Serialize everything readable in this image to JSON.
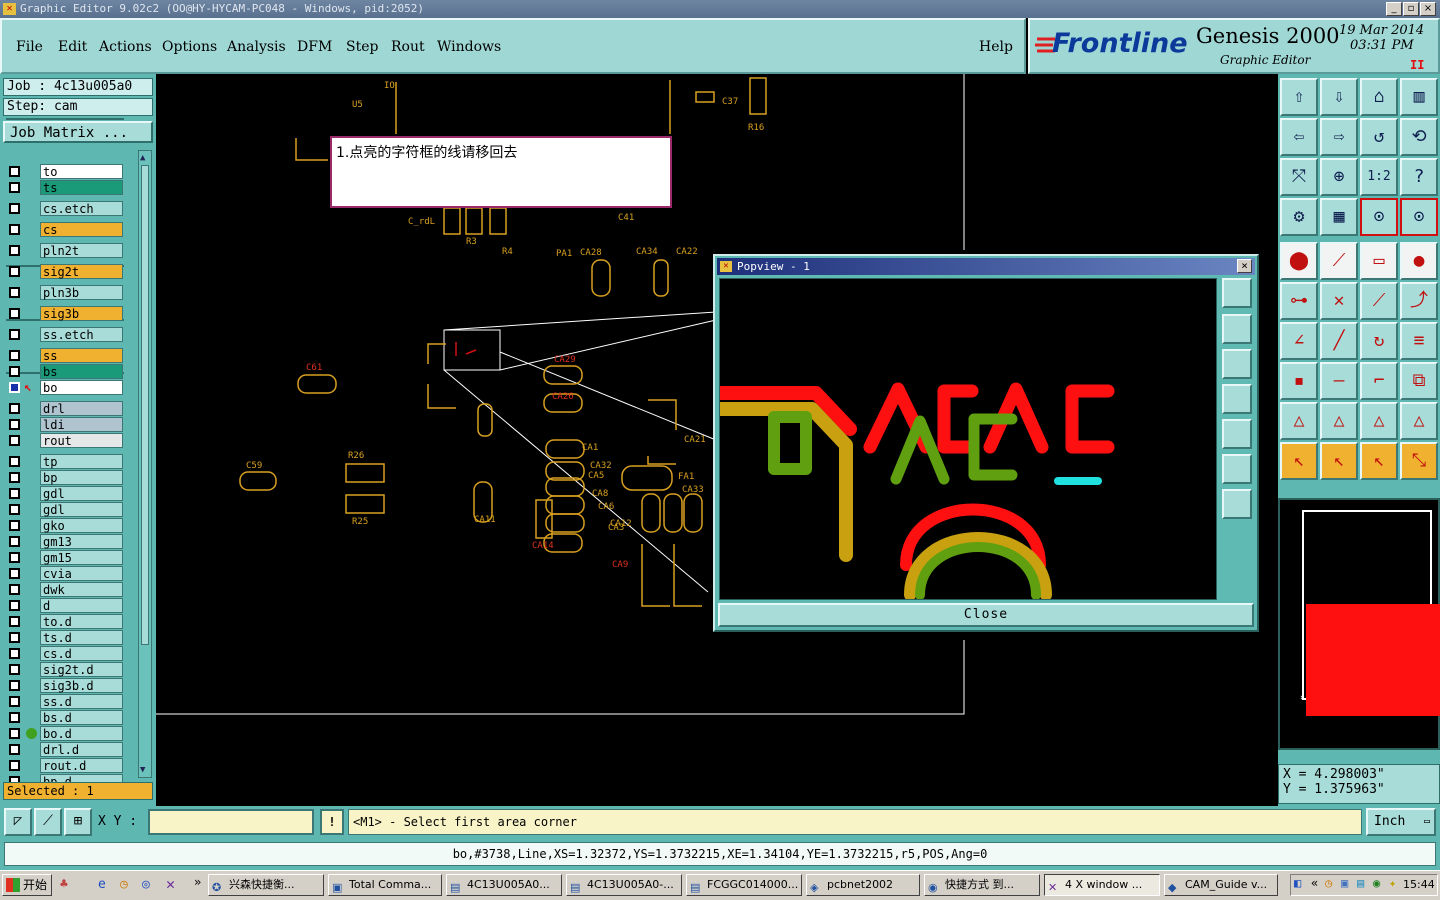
{
  "window": {
    "title": "Graphic Editor 9.02c2 (OO@HY-HYCAM-PC048 - Windows, pid:2052)"
  },
  "menu": {
    "items": [
      "File",
      "Edit",
      "Actions",
      "Options",
      "Analysis",
      "DFM",
      "Step",
      "Rout",
      "Windows"
    ],
    "help": "Help"
  },
  "brand": {
    "company": "Frontline",
    "product": "Genesis 2000",
    "subtitle": "Graphic Editor",
    "date": "19 Mar 2014",
    "time": "03:31 PM"
  },
  "job": {
    "job_label": "Job : 4c13u005a0",
    "step_label": "Step: cam",
    "matrix_button": "Job Matrix ..."
  },
  "layers": [
    {
      "name": "to",
      "color": "#ffffff",
      "on": false
    },
    {
      "name": "ts",
      "color": "#1a9a78",
      "on": false
    },
    {
      "name": "cs.etch",
      "color": "#a8dcd8",
      "on": false
    },
    {
      "name": "cs",
      "color": "#f0b030",
      "on": false
    },
    {
      "name": "pln2t",
      "color": "#a8dcd8",
      "on": false
    },
    {
      "name": "sig2t",
      "color": "#f0b030",
      "on": false
    },
    {
      "name": "pln3b",
      "color": "#a8dcd8",
      "on": false
    },
    {
      "name": "sig3b",
      "color": "#f0b030",
      "on": false
    },
    {
      "name": "ss.etch",
      "color": "#a8dcd8",
      "on": false
    },
    {
      "name": "ss",
      "color": "#f0b030",
      "on": false
    },
    {
      "name": "bs",
      "color": "#1a9a78",
      "on": false
    },
    {
      "name": "bo",
      "color": "#ffffff",
      "on": true
    },
    {
      "name": "drl",
      "color": "#b0c4d0",
      "on": false
    },
    {
      "name": "ldi",
      "color": "#b0c4d0",
      "on": false
    },
    {
      "name": "rout",
      "color": "#e4e8e8",
      "on": false
    },
    {
      "name": "tp",
      "color": "#a8dcd8",
      "on": false
    },
    {
      "name": "bp",
      "color": "#a8dcd8",
      "on": false
    },
    {
      "name": "gdl",
      "color": "#a8dcd8",
      "on": false
    },
    {
      "name": "gdl",
      "color": "#a8dcd8",
      "on": false
    },
    {
      "name": "gko",
      "color": "#a8dcd8",
      "on": false
    },
    {
      "name": "gm13",
      "color": "#a8dcd8",
      "on": false
    },
    {
      "name": "gm15",
      "color": "#a8dcd8",
      "on": false
    },
    {
      "name": "cvia",
      "color": "#a8dcd8",
      "on": false
    },
    {
      "name": "dwk",
      "color": "#a8dcd8",
      "on": false
    },
    {
      "name": "d",
      "color": "#a8dcd8",
      "on": false
    },
    {
      "name": "to.d",
      "color": "#a8dcd8",
      "on": false
    },
    {
      "name": "ts.d",
      "color": "#a8dcd8",
      "on": false
    },
    {
      "name": "cs.d",
      "color": "#a8dcd8",
      "on": false
    },
    {
      "name": "sig2t.d",
      "color": "#a8dcd8",
      "on": false
    },
    {
      "name": "sig3b.d",
      "color": "#a8dcd8",
      "on": false
    },
    {
      "name": "ss.d",
      "color": "#a8dcd8",
      "on": false
    },
    {
      "name": "bs.d",
      "color": "#a8dcd8",
      "on": false
    },
    {
      "name": "bo.d",
      "color": "#a8dcd8",
      "on": false
    },
    {
      "name": "drl.d",
      "color": "#a8dcd8",
      "on": false
    },
    {
      "name": "rout.d",
      "color": "#a8dcd8",
      "on": false
    },
    {
      "name": "bp.d",
      "color": "#a8dcd8",
      "on": false
    }
  ],
  "selected_label": "Selected : 1",
  "note": "1.点亮的字符框的线请移回去",
  "canvas_labels": [
    "U5",
    "IO",
    "C37",
    "R16",
    "C_rdL",
    "R3",
    "R4",
    "C41",
    "CA28",
    "PA1",
    "CA34",
    "CA22",
    "CA29",
    "C61",
    "CA26",
    "CA9",
    "CA14",
    "CA11",
    "CA21",
    "CA32",
    "FA1",
    "CA33",
    "CA12",
    "C59",
    "R26",
    "R25",
    "CA1",
    "CA5",
    "CA8",
    "CA6",
    "CA3"
  ],
  "popview": {
    "title": "Popview - 1",
    "close_label": "Close",
    "glyph_red": "CA9AC",
    "glyph_green": "CA9"
  },
  "coords": {
    "x": "X = 4.298003\"",
    "y": "Y = 1.375963\""
  },
  "command": {
    "xy_label": "X Y :",
    "xy_value": "",
    "prompt": "<M1> - Select first area corner",
    "units": "Inch"
  },
  "status": "bo,#3738,Line,XS=1.32372,YS=1.3732215,XE=1.34104,YE=1.3732215,r5,POS,Ang=0",
  "taskbar": {
    "start": "开始",
    "tasks": [
      "兴森快捷衡...",
      "Total Comma...",
      "4C13U005A0...",
      "4C13U005A0-...",
      "FCGGC014000...",
      "pcbnet2002",
      "快捷方式 到...",
      "4 X window ...",
      "CAM_Guide v..."
    ],
    "clock": "15:44"
  },
  "colors": {
    "accent": "#5fb7b2",
    "red": "#ff1010",
    "yellow": "#f0b030",
    "green": "#60a010",
    "cyan": "#20e0e0"
  }
}
